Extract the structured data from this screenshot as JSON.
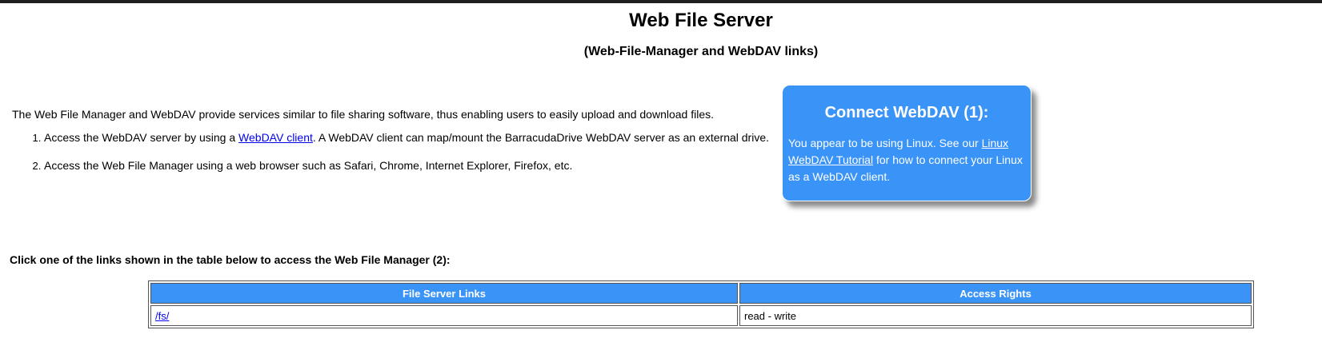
{
  "page": {
    "title": "Web File Server",
    "subtitle": "(Web-File-Manager and WebDAV links)"
  },
  "intro": {
    "text": "The Web File Manager and WebDAV provide services similar to file sharing software, thus enabling users to easily upload and download files."
  },
  "steps": [
    {
      "before": "Access the WebDAV server by using a ",
      "link": "WebDAV client",
      "after": ". A WebDAV client can map/mount the BarracudaDrive WebDAV server as an external drive."
    },
    {
      "text": "Access the Web File Manager using a web browser such as Safari, Chrome, Internet Explorer, Firefox, etc."
    }
  ],
  "connect": {
    "title": "Connect WebDAV (1):",
    "text_before": "You appear to be using Linux. See our ",
    "link": "Linux WebDAV Tutorial",
    "text_after": " for how to connect your Linux as a WebDAV client."
  },
  "table_intro": "Click one of the links shown in the table below to access the Web File Manager (2):",
  "table": {
    "headers": [
      "File Server Links",
      "Access Rights"
    ],
    "rows": [
      {
        "link": "/fs/",
        "rights": "read - write"
      }
    ]
  },
  "colors": {
    "accent_blue": "#3a93f6",
    "link": "#0000ee",
    "top_bar": "#1f1f1f"
  }
}
